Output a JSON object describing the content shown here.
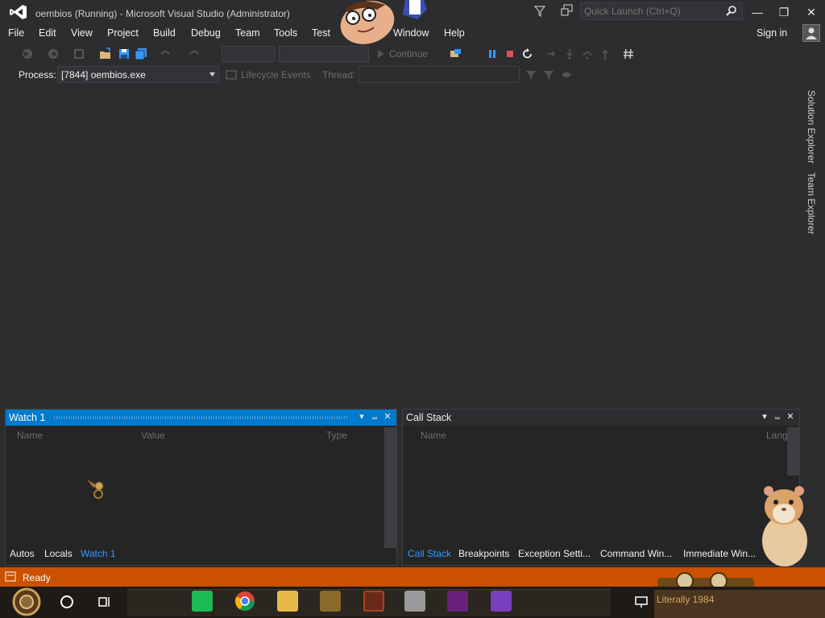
{
  "window": {
    "title": "oembios (Running) - Microsoft Visual Studio  (Administrator)",
    "quick_launch_placeholder": "Quick Launch (Ctrl+Q)"
  },
  "menu": [
    "File",
    "Edit",
    "View",
    "Project",
    "Build",
    "Debug",
    "Team",
    "Tools",
    "Test",
    "Window",
    "Help"
  ],
  "sign_in": "Sign in",
  "toolbar": {
    "continue_label": "Continue"
  },
  "debug_location": {
    "process_label": "Process:",
    "process_value": "[7844] oembios.exe",
    "lifecycle_label": "Lifecycle Events",
    "thread_label": "Thread:"
  },
  "side_tabs": [
    "Solution Explorer",
    "Team Explorer"
  ],
  "watch_panel": {
    "title": "Watch 1",
    "columns": [
      "Name",
      "Value",
      "Type"
    ],
    "bottom_tabs": [
      "Autos",
      "Locals",
      "Watch 1"
    ],
    "active_tab": "Watch 1"
  },
  "callstack_panel": {
    "title": "Call Stack",
    "columns": [
      "Name",
      "Lang"
    ],
    "bottom_tabs": [
      "Call Stack",
      "Breakpoints",
      "Exception Setti...",
      "Command Win...",
      "Immediate Win..."
    ],
    "active_tab": "Call Stack"
  },
  "status": {
    "text": "Ready",
    "color": "#ca5100"
  },
  "taskbar": {
    "tray_text": "Literally 1984"
  },
  "colors": {
    "accent": "#007acc",
    "active_tab": "#3399ff",
    "status_bar": "#ca5100"
  }
}
